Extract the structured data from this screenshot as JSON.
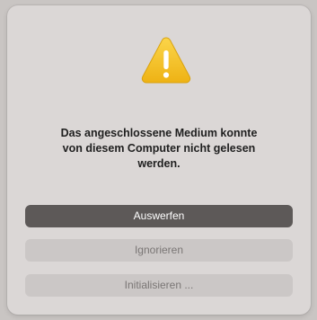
{
  "dialog": {
    "icon": "warning-icon",
    "message_line1": "Das angeschlossene Medium konnte",
    "message_line2": "von diesem Computer nicht gelesen",
    "message_line3": "werden.",
    "buttons": {
      "eject_label": "Auswerfen",
      "ignore_label": "Ignorieren",
      "initialize_label": "Initialisieren ..."
    }
  },
  "colors": {
    "warning_yellow": "#f5c22e",
    "primary_button": "#5d5958",
    "secondary_button": "#cbc7c6",
    "dialog_background": "#dbd7d6"
  }
}
